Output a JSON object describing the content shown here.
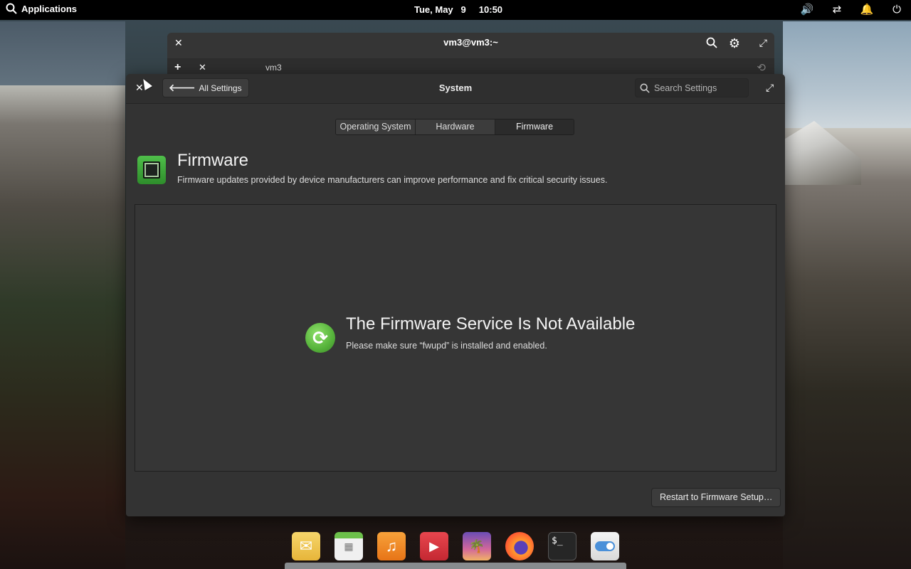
{
  "top_panel": {
    "applications_label": "Applications",
    "clock": "Tue, May   9     10:50",
    "tray_icons": [
      "volume-icon",
      "network-icon",
      "notifications-icon",
      "power-icon"
    ]
  },
  "terminal": {
    "title": "vm3@vm3:~",
    "tab_label": "vm3"
  },
  "settings": {
    "back_label": "All Settings",
    "title": "System",
    "search_placeholder": "Search Settings",
    "tabs": [
      {
        "label": "Operating System",
        "active": false
      },
      {
        "label": "Hardware",
        "active": false
      },
      {
        "label": "Firmware",
        "active": true
      }
    ],
    "header_title": "Firmware",
    "header_desc": "Firmware updates provided by device manufacturers can improve performance and fix critical security issues.",
    "placeholder_title": "The Firmware Service Is Not Available",
    "placeholder_desc": "Please make sure “fwupd” is installed and enabled.",
    "restart_label": "Restart to Firmware Setup…"
  },
  "dock": {
    "items": [
      {
        "name": "mail",
        "color": "#f1c34a"
      },
      {
        "name": "calendar",
        "color": "#e9e9e9"
      },
      {
        "name": "music",
        "color": "#f08a1e"
      },
      {
        "name": "videos",
        "color": "#d9363e"
      },
      {
        "name": "photos",
        "color": "#8e6bc5"
      },
      {
        "name": "firefox",
        "color": "#ff7139"
      },
      {
        "name": "terminal",
        "color": "#2b2b2b"
      },
      {
        "name": "settings",
        "color": "#e6e6e6"
      }
    ]
  },
  "colors": {
    "accent_green": "#55b23a",
    "window_bg": "#333333"
  }
}
